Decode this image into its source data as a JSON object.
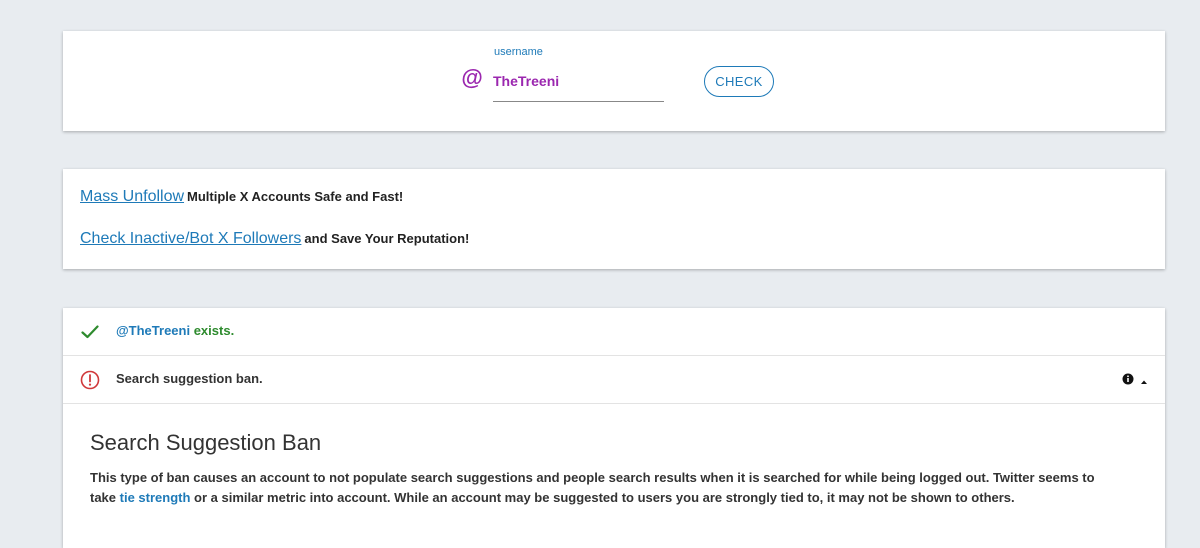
{
  "search": {
    "label": "username",
    "at_symbol": "@",
    "value": "TheTreeni",
    "button_label": "CHECK"
  },
  "promo": {
    "line1_link": "Mass Unfollow",
    "line1_text": "Multiple X Accounts Safe and Fast!",
    "line2_link": "Check Inactive/Bot X Followers",
    "line2_text": "and Save Your Reputation!"
  },
  "results": {
    "exists": {
      "handle": "@TheTreeni",
      "status": " exists.",
      "icon": "check-icon",
      "color": "#2e8b2e"
    },
    "ban": {
      "status": "Search suggestion ban.",
      "icon": "alert-circle-icon",
      "color": "#d0393b"
    }
  },
  "detail": {
    "title": "Search Suggestion Ban",
    "text_before": "This type of ban causes an account to not populate search suggestions and people search results when it is searched for while being logged out. Twitter seems to take ",
    "link": "tie strength",
    "text_after": " or a similar metric into account. While an account may be suggested to users you are strongly tied to, it may not be shown to others."
  },
  "colors": {
    "accent": "#1e7ab8",
    "brand": "#9b27af",
    "background": "#e8ecf0"
  }
}
